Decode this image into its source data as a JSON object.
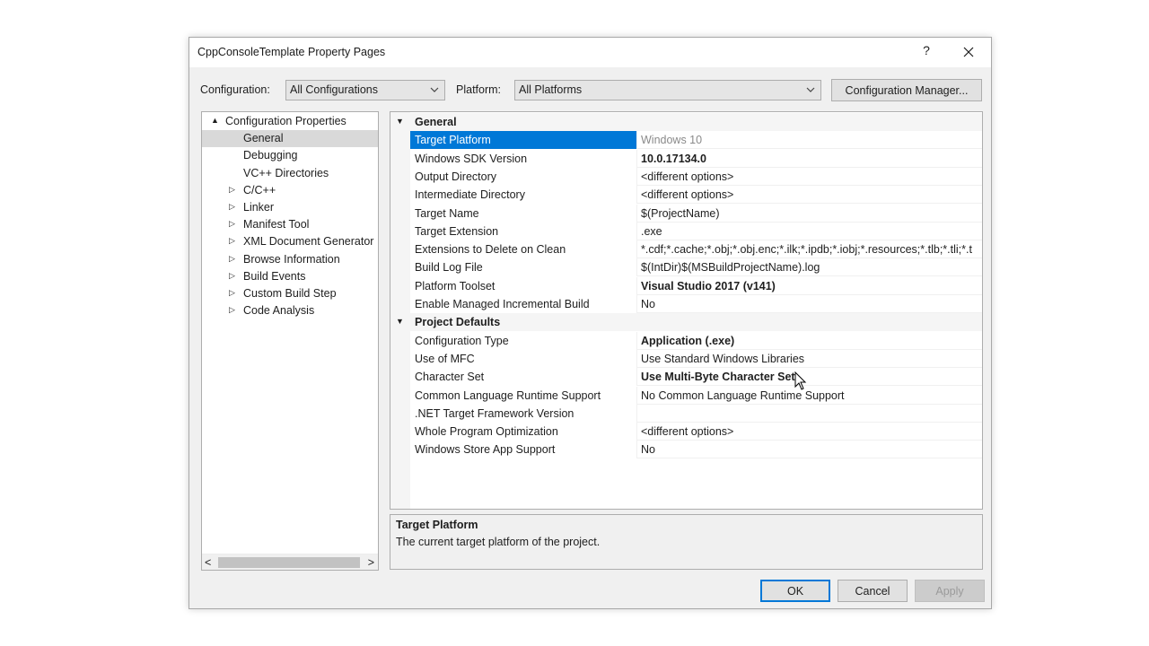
{
  "window": {
    "title": "CppConsoleTemplate Property Pages",
    "help_label": "?",
    "close_icon": "close-icon"
  },
  "config_bar": {
    "configuration_label": "Configuration:",
    "configuration_value": "All Configurations",
    "platform_label": "Platform:",
    "platform_value": "All Platforms",
    "config_manager_label": "Configuration Manager..."
  },
  "tree": {
    "items": [
      {
        "label": "Configuration Properties",
        "arrow": "▲",
        "selected": false
      },
      {
        "label": "General",
        "arrow": "",
        "selected": true
      },
      {
        "label": "Debugging",
        "arrow": "",
        "selected": false
      },
      {
        "label": "VC++ Directories",
        "arrow": "",
        "selected": false
      },
      {
        "label": "C/C++",
        "arrow": "▷",
        "selected": false
      },
      {
        "label": "Linker",
        "arrow": "▷",
        "selected": false
      },
      {
        "label": "Manifest Tool",
        "arrow": "▷",
        "selected": false
      },
      {
        "label": "XML Document Generator",
        "arrow": "▷",
        "selected": false
      },
      {
        "label": "Browse Information",
        "arrow": "▷",
        "selected": false
      },
      {
        "label": "Build Events",
        "arrow": "▷",
        "selected": false
      },
      {
        "label": "Custom Build Step",
        "arrow": "▷",
        "selected": false
      },
      {
        "label": "Code Analysis",
        "arrow": "▷",
        "selected": false
      }
    ],
    "scroll_left": "<",
    "scroll_right": ">"
  },
  "grid": {
    "sections": [
      {
        "title": "General",
        "arrow": "▼",
        "rows": [
          {
            "name": "Target Platform",
            "value": "Windows 10",
            "style": "dim",
            "selected": true
          },
          {
            "name": "Windows SDK Version",
            "value": "10.0.17134.0",
            "style": "bold"
          },
          {
            "name": "Output Directory",
            "value": "<different options>",
            "style": ""
          },
          {
            "name": "Intermediate Directory",
            "value": "<different options>",
            "style": ""
          },
          {
            "name": "Target Name",
            "value": "$(ProjectName)",
            "style": ""
          },
          {
            "name": "Target Extension",
            "value": ".exe",
            "style": ""
          },
          {
            "name": "Extensions to Delete on Clean",
            "value": "*.cdf;*.cache;*.obj;*.obj.enc;*.ilk;*.ipdb;*.iobj;*.resources;*.tlb;*.tli;*.t",
            "style": ""
          },
          {
            "name": "Build Log File",
            "value": "$(IntDir)$(MSBuildProjectName).log",
            "style": ""
          },
          {
            "name": "Platform Toolset",
            "value": "Visual Studio 2017 (v141)",
            "style": "bold"
          },
          {
            "name": "Enable Managed Incremental Build",
            "value": "No",
            "style": ""
          }
        ]
      },
      {
        "title": "Project Defaults",
        "arrow": "▼",
        "rows": [
          {
            "name": "Configuration Type",
            "value": "Application (.exe)",
            "style": "bold"
          },
          {
            "name": "Use of MFC",
            "value": "Use Standard Windows Libraries",
            "style": ""
          },
          {
            "name": "Character Set",
            "value": "Use Multi-Byte Character Set",
            "style": "bold"
          },
          {
            "name": "Common Language Runtime Support",
            "value": "No Common Language Runtime Support",
            "style": ""
          },
          {
            "name": ".NET Target Framework Version",
            "value": "",
            "style": ""
          },
          {
            "name": "Whole Program Optimization",
            "value": "<different options>",
            "style": ""
          },
          {
            "name": "Windows Store App Support",
            "value": "No",
            "style": ""
          }
        ]
      }
    ]
  },
  "description": {
    "title": "Target Platform",
    "text": "The current target platform of the project."
  },
  "buttons": {
    "ok": "OK",
    "cancel": "Cancel",
    "apply": "Apply"
  },
  "colors": {
    "selection": "#0078d7",
    "dialog_bg": "#f0f0f0"
  }
}
